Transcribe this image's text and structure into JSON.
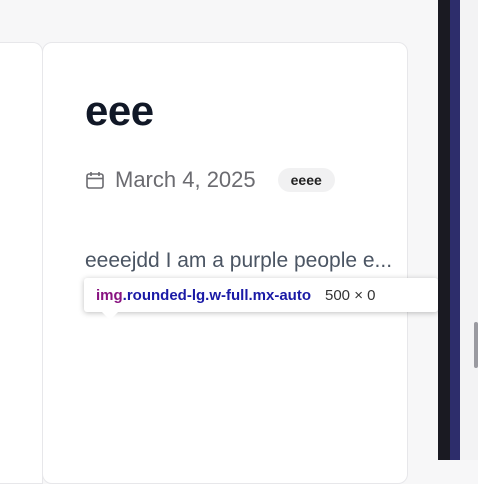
{
  "post": {
    "title": "eee",
    "date": "March 4, 2025",
    "tag": "eeee",
    "body": "eeeejdd I am a purple people e..."
  },
  "inspector_tooltip": {
    "tag": "img",
    "classes": ".rounded-lg.w-full.mx-auto",
    "size": "500 × 0"
  },
  "icons": {
    "calendar": "calendar-icon"
  },
  "colors": {
    "title": "#111827",
    "tooltip_tag": "#881280",
    "tooltip_classes": "#1a1aa6"
  }
}
